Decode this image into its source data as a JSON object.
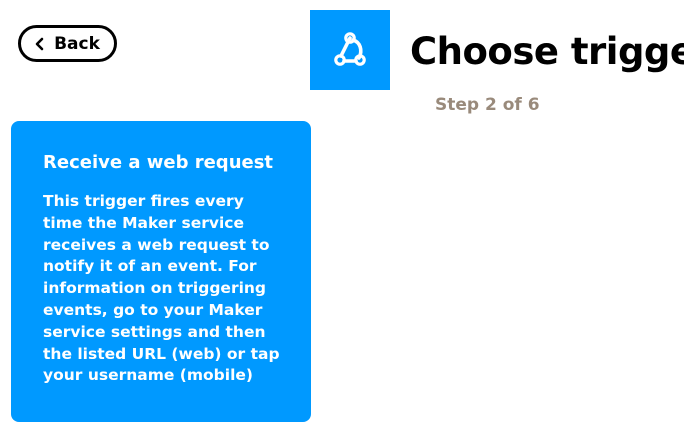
{
  "header": {
    "back_label": "Back",
    "title": "Choose trigger",
    "step": "Step 2 of 6",
    "service_icon": "webhooks-icon"
  },
  "trigger": {
    "title": "Receive a web request",
    "description": "This trigger fires every time the Maker service receives a web request to notify it of an event. For information on triggering events, go to your Maker service settings and then the listed URL (web) or tap your username (mobile)"
  },
  "colors": {
    "accent": "#0099ff",
    "step_text": "#998a7b",
    "text": "#000000",
    "card_text": "#ffffff"
  }
}
